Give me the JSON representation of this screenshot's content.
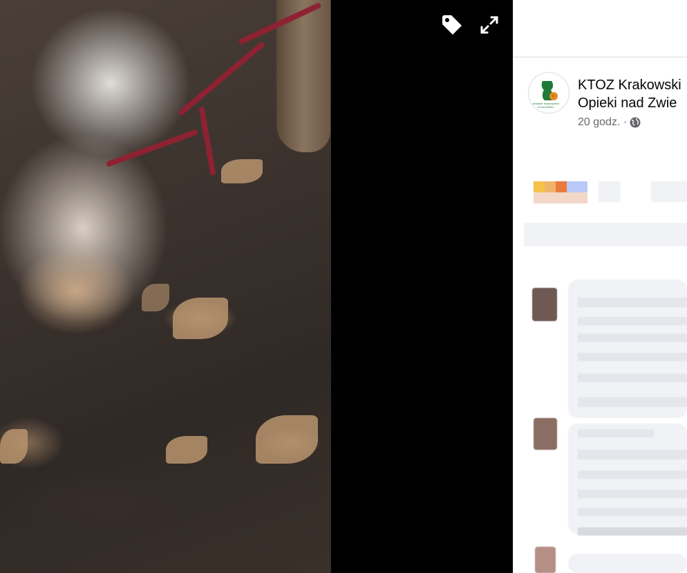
{
  "viewer": {
    "photo_alt": "Zdjęcie psa leżącego na ziemi, przywiązanego sznurem do drzewa",
    "tag_icon": "tag-icon",
    "expand_icon": "expand-icon"
  },
  "post": {
    "author_line1": "KTOZ Krakowski",
    "author_line2": "Opieki nad Zwie",
    "time": "20 godz. ·",
    "audience_icon": "globe-icon"
  },
  "colors": {
    "panel_bg": "#ffffff",
    "viewer_bg": "#000000",
    "meta_text": "#65676b",
    "name_text": "#050505",
    "logo_green": "#1f7a3a",
    "logo_orange": "#e8891d"
  }
}
